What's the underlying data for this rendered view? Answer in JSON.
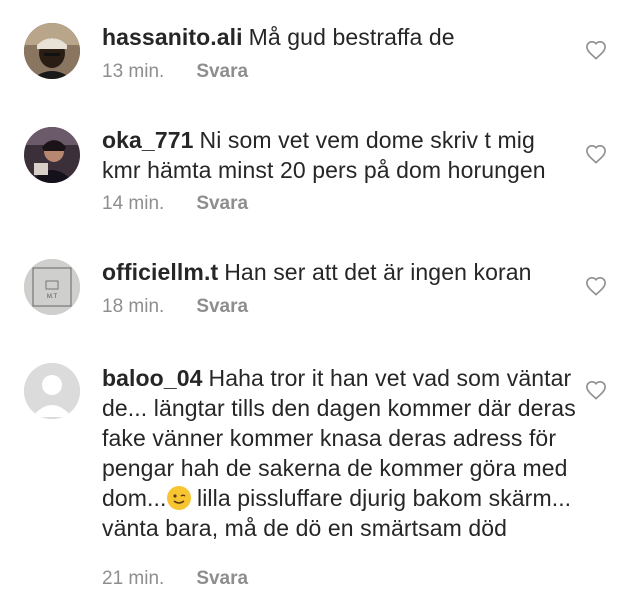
{
  "comments": [
    {
      "username": "hassanito.ali",
      "text": "Må gud bestraffa de",
      "time": "13 min.",
      "reply": "Svara",
      "avatar": "profile-photo"
    },
    {
      "username": "oka_771",
      "text": "Ni som vet vem dome skriv t mig kmr hämta minst 20 pers på dom horungen",
      "time": "14 min.",
      "reply": "Svara",
      "avatar": "profile-photo"
    },
    {
      "username": "officiellm.t",
      "text": "Han ser att det är ingen koran",
      "time": "18 min.",
      "reply": "Svara",
      "avatar": "logo-avatar",
      "avatar_label": "M.T"
    },
    {
      "username": "baloo_04",
      "text_before": "Haha tror it han vet vad som väntar de... längtar tills den dagen kommer där deras fake vänner kommer knasa deras adress för pengar hah de sakerna de kommer göra med dom...",
      "text_after": " lilla pissluffare djurig bakom skärm... vänta bara, må de dö en smärtsam död",
      "emoji": "winking-face-icon",
      "time": "21 min.",
      "reply": "Svara",
      "avatar": "default-avatar"
    }
  ],
  "colors": {
    "text": "#262626",
    "meta": "#8e8e8e",
    "avatar_default": "#dbdbdb"
  }
}
